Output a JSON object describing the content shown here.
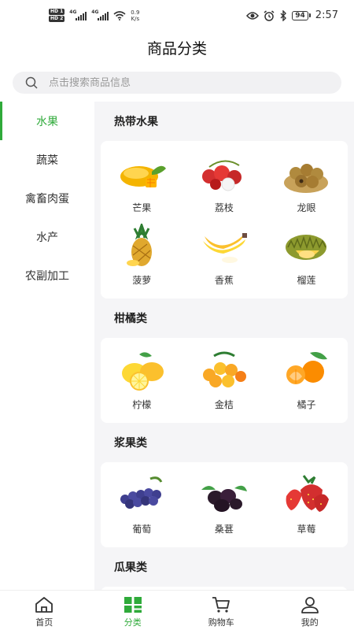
{
  "status_bar": {
    "hd1": "HD 1",
    "hd2": "HD 2",
    "net1": "4G",
    "net2": "4G",
    "speed_value": "0.9",
    "speed_unit": "K/s",
    "battery": "94",
    "time": "2:57",
    "icons": [
      "eye-icon",
      "alarm-icon",
      "bluetooth-icon",
      "wifi-icon",
      "battery-icon"
    ]
  },
  "header": {
    "title": "商品分类"
  },
  "search": {
    "placeholder": "点击搜索商品信息"
  },
  "sidebar": {
    "items": [
      {
        "label": "水果",
        "active": true
      },
      {
        "label": "蔬菜"
      },
      {
        "label": "禽畜肉蛋"
      },
      {
        "label": "水产"
      },
      {
        "label": "农副加工"
      }
    ]
  },
  "sections": [
    {
      "title": "热带水果",
      "items": [
        {
          "label": "芒果",
          "icon": "mango-icon"
        },
        {
          "label": "荔枝",
          "icon": "lychee-icon"
        },
        {
          "label": "龙眼",
          "icon": "longan-icon"
        },
        {
          "label": "菠萝",
          "icon": "pineapple-icon"
        },
        {
          "label": "香蕉",
          "icon": "banana-icon"
        },
        {
          "label": "榴莲",
          "icon": "durian-icon"
        }
      ]
    },
    {
      "title": "柑橘类",
      "items": [
        {
          "label": "柠檬",
          "icon": "lemon-icon"
        },
        {
          "label": "金桔",
          "icon": "kumquat-icon"
        },
        {
          "label": "橘子",
          "icon": "tangerine-icon"
        }
      ]
    },
    {
      "title": "浆果类",
      "items": [
        {
          "label": "葡萄",
          "icon": "grape-icon"
        },
        {
          "label": "桑葚",
          "icon": "mulberry-icon"
        },
        {
          "label": "草莓",
          "icon": "strawberry-icon"
        }
      ]
    },
    {
      "title": "瓜果类",
      "items": []
    }
  ],
  "tabbar": {
    "tabs": [
      {
        "label": "首页",
        "icon": "home-icon"
      },
      {
        "label": "分类",
        "icon": "category-icon",
        "active": true
      },
      {
        "label": "购物车",
        "icon": "cart-icon"
      },
      {
        "label": "我的",
        "icon": "user-icon"
      }
    ]
  },
  "colors": {
    "accent": "#2faa3a",
    "content_bg": "#f5f5f7",
    "search_bg": "#f1f1f3"
  }
}
